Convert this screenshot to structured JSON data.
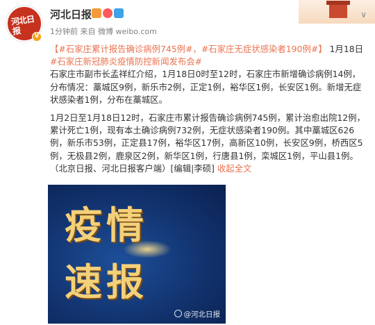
{
  "post": {
    "author": "河北日报",
    "verified_badge": "V",
    "avatar_text": "河北日报",
    "meta_time": "1分钟前",
    "meta_from": "来自",
    "meta_source": "微博 weibo.com",
    "topics": [
      "【#石家庄累计报告确诊病例745例#，#石家庄无症状感染者190例#】",
      "#石家庄新冠肺炎疫情防控新闻发布会#"
    ],
    "date_text": "1月18日",
    "paragraph1": "石家庄市副市长孟祥红介绍，1月18日0时至12时，石家庄市新增确诊病例14例，分布情况：藁城区9例，新乐市2例，正定1例，裕华区1例，长安区1例。新增无症状感染者1例，分布在藁城区。",
    "paragraph2": "1月2日至1月18日12时，石家庄市累计报告确诊病例745例，累计治愈出院12例，累计死亡1例，现有本土确诊病例732例，无症状感染者190例。其中藁城区626例，新乐市53例，正定县17例，裕华区17例，高新区10例，长安区9例，桥西区5例，无极县2例，鹿泉区2例，新华区1例，行唐县1例，栾城区1例，平山县1例。",
    "credit": "（北京日报、河北日报客户端）[编辑|李硕]",
    "expand_link": "收起全文",
    "image": {
      "line1": "疫情",
      "line2": "速报",
      "watermark": "@河北日报"
    },
    "caret": "∨",
    "colors": {
      "link": "#eb7350",
      "image_bg": "#12336f",
      "image_text": "#f3d07a"
    }
  }
}
